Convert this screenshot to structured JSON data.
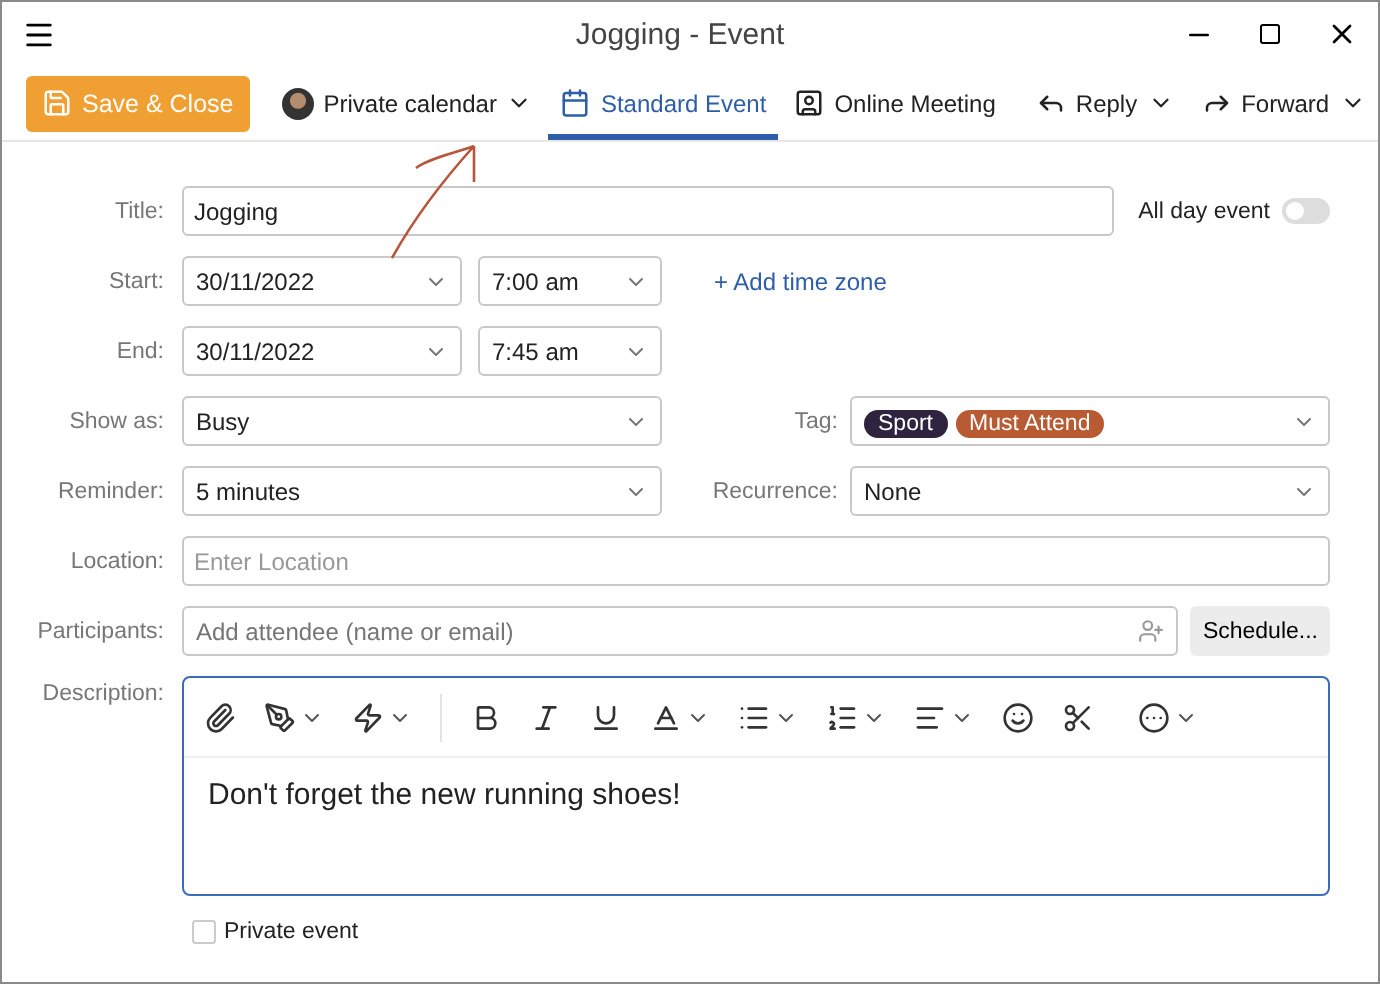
{
  "window": {
    "title": "Jogging - Event"
  },
  "toolbar": {
    "items": [
      {
        "kind": "primary",
        "label": "Save & Close"
      },
      {
        "kind": "calendar",
        "label": "Private calendar"
      },
      {
        "kind": "tab",
        "label": "Standard Event",
        "selected": true
      },
      {
        "kind": "tab",
        "label": "Online Meeting",
        "selected": false
      },
      {
        "kind": "menu",
        "label": "Reply"
      },
      {
        "kind": "menu",
        "label": "Forward"
      }
    ]
  },
  "form": {
    "title": {
      "label": "Title:",
      "value": "Jogging"
    },
    "all_day": {
      "label": "All day event",
      "on": false
    },
    "start": {
      "label": "Start:",
      "date": "30/11/2022",
      "time": "7:00 am"
    },
    "add_time_zone": "+ Add time zone",
    "end": {
      "label": "End:",
      "date": "30/11/2022",
      "time": "7:45 am"
    },
    "show_as": {
      "label": "Show as:",
      "value": "Busy"
    },
    "tag": {
      "label": "Tag:",
      "tags": [
        {
          "text": "Sport",
          "color": "#2e2440"
        },
        {
          "text": "Must Attend",
          "color": "#b85a32"
        }
      ]
    },
    "reminder": {
      "label": "Reminder:",
      "value": "5 minutes"
    },
    "recurrence": {
      "label": "Recurrence:",
      "value": "None"
    },
    "location": {
      "label": "Location:",
      "placeholder": "Enter Location"
    },
    "participants": {
      "label": "Participants:",
      "placeholder": "Add attendee (name or email)",
      "button": "Schedule..."
    },
    "description": {
      "label": "Description:",
      "text": "Don't forget the new running shoes!"
    },
    "private_event": {
      "label": "Private event",
      "checked": false
    }
  }
}
